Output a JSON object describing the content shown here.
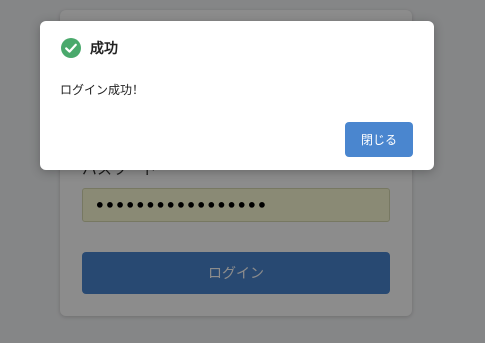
{
  "login_form": {
    "password_label": "パスワード",
    "password_value": "•••••••••••••••••",
    "login_button_label": "ログイン"
  },
  "dialog": {
    "icon": "check-circle-icon",
    "title": "成功",
    "message": "ログイン成功！",
    "close_button_label": "閉じる"
  },
  "colors": {
    "accent": "#4a86cf",
    "success": "#4aa96c",
    "input_autofill_bg": "#fbfcd6",
    "backdrop": "rgba(0,0,0,0.45)"
  }
}
